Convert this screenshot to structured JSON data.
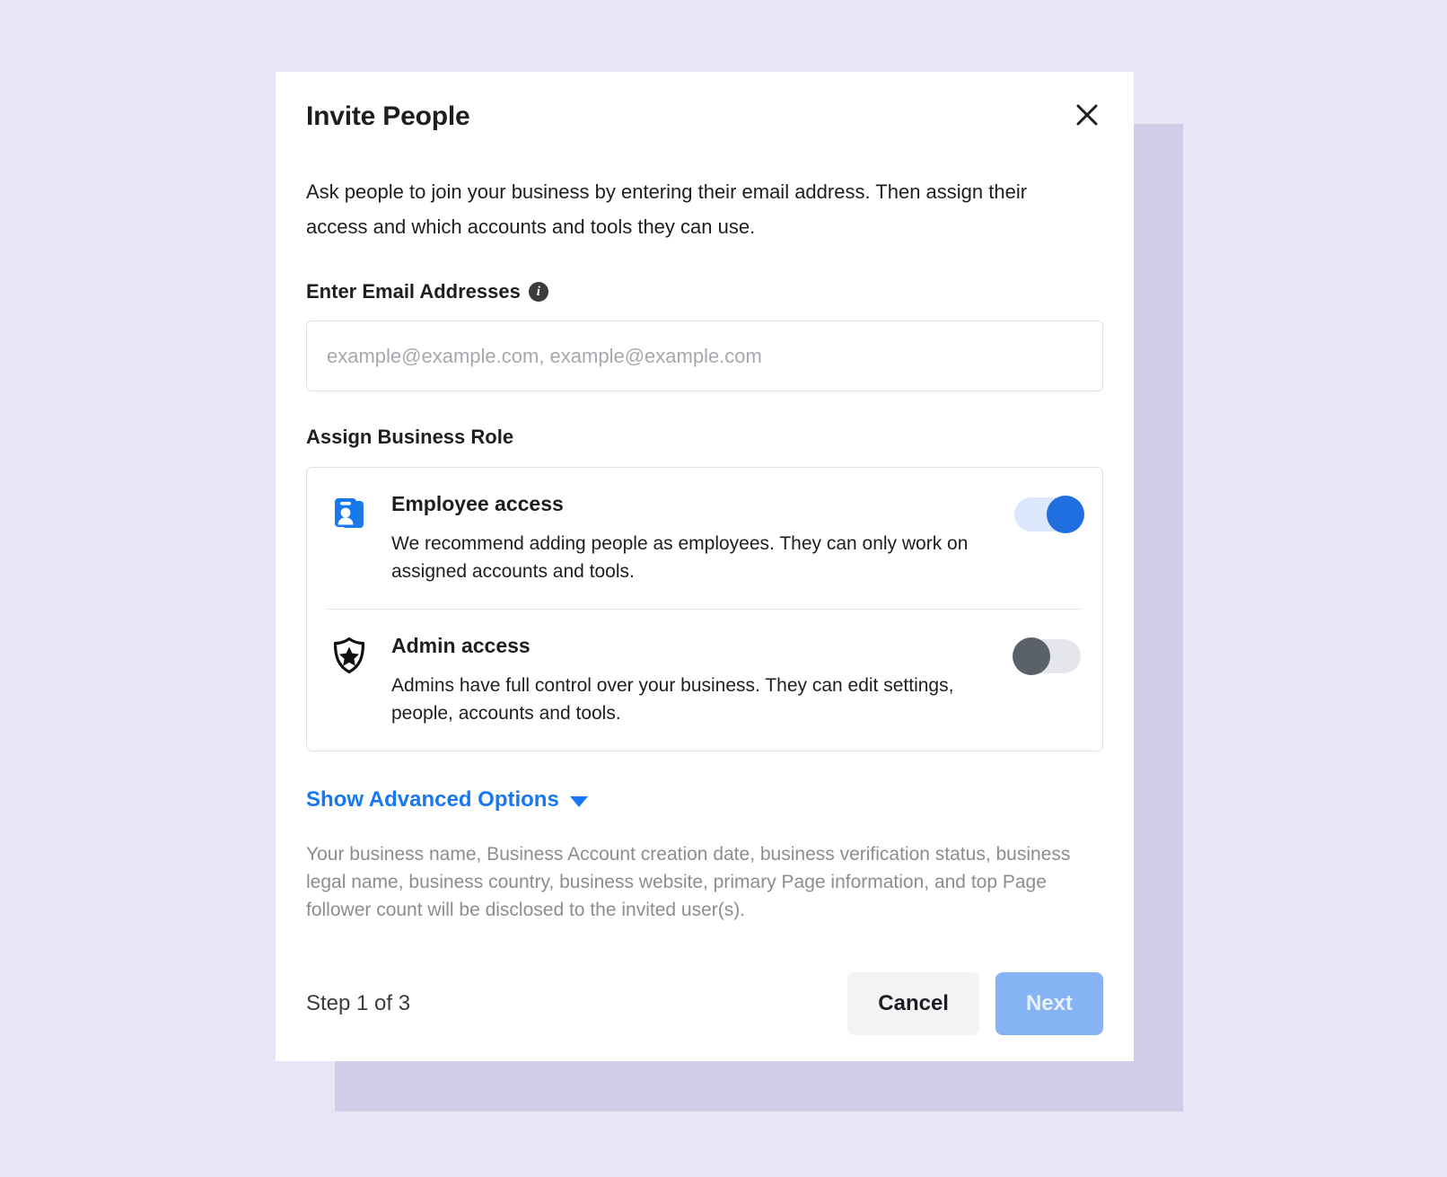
{
  "background": {
    "page_color": "#e7e6f6",
    "panel_color": "#d0cde8"
  },
  "dialog": {
    "title": "Invite People",
    "close_icon": "close-icon",
    "intro": "Ask people to join your business by entering their email address. Then assign their access and which accounts and tools they can use.",
    "email_section": {
      "label": "Enter Email Addresses",
      "info_icon": "info-icon",
      "info_glyph": "i",
      "input_value": "",
      "placeholder": "example@example.com, example@example.com"
    },
    "role_section": {
      "label": "Assign Business Role",
      "roles": [
        {
          "icon": "employee-badge-icon",
          "title": "Employee access",
          "description": "We recommend adding people as employees. They can only work on assigned accounts and tools.",
          "toggle_state": "on",
          "toggle_track_color": "#dce7fb",
          "toggle_knob_color": "#1f6fe0"
        },
        {
          "icon": "shield-star-icon",
          "title": "Admin access",
          "description": "Admins have full control over your business. They can edit settings, people, accounts and tools.",
          "toggle_state": "off",
          "toggle_track_color": "#e4e6eb",
          "toggle_knob_color": "#5b6169"
        }
      ]
    },
    "advanced": {
      "label": "Show Advanced Options",
      "caret_icon": "chevron-down-icon",
      "link_color": "#1877f2"
    },
    "disclosure": "Your business name, Business Account creation date, business verification status, business legal name, business country, business website, primary Page information, and top Page follower count will be disclosed to the invited user(s).",
    "footer": {
      "step_text": "Step 1 of 3",
      "cancel_label": "Cancel",
      "next_label": "Next",
      "next_color": "#85b3f3"
    }
  }
}
